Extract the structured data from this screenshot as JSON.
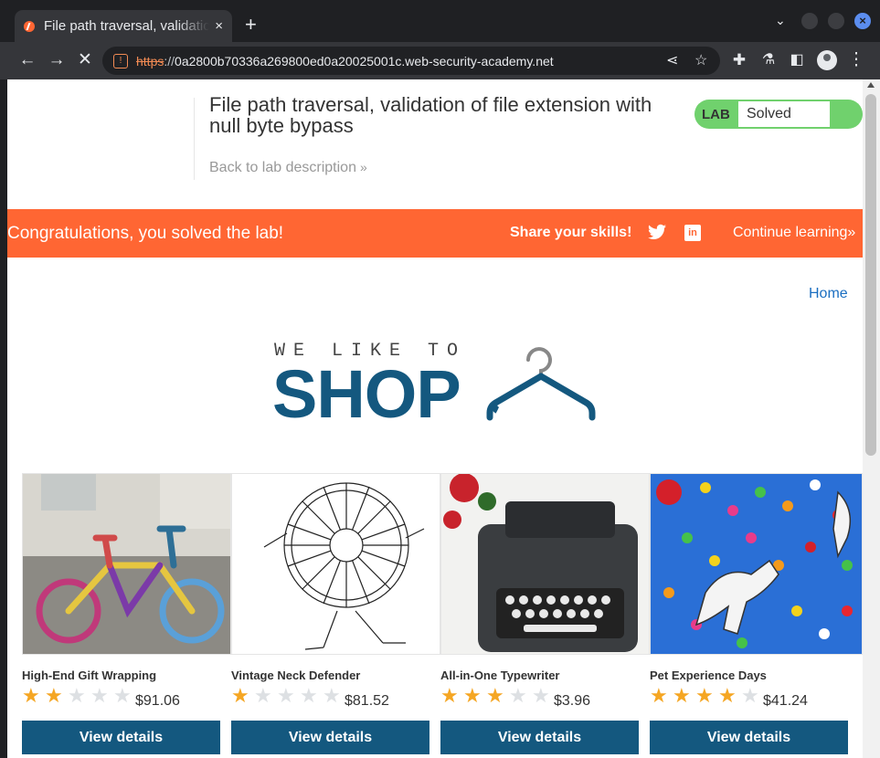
{
  "browser": {
    "tab_title": "File path traversal, validation of file extension with null byte bypass",
    "tab_close": "×",
    "new_tab": "+",
    "url_scheme": "https",
    "url_sep": "://",
    "url_host": "0a2800b70336a269800ed0a20025001c.web-security-academy.net"
  },
  "lab": {
    "title": "File path traversal, validation of file extension with null byte bypass",
    "back_link": "Back to lab description",
    "back_chevron": "»",
    "badge_label": "LAB",
    "badge_status": "Solved"
  },
  "banner": {
    "message": "Congratulations, you solved the lab!",
    "share": "Share your skills!",
    "linkedin": "in",
    "continue": "Continue learning",
    "continue_chevron": "»"
  },
  "nav": {
    "home": "Home"
  },
  "logo": {
    "tagline": "WE LIKE TO",
    "word": "SHOP"
  },
  "products": [
    {
      "name": "High-End Gift Wrapping",
      "rating": 2,
      "price": "$91.06",
      "button": "View details"
    },
    {
      "name": "Vintage Neck Defender",
      "rating": 1,
      "price": "$81.52",
      "button": "View details"
    },
    {
      "name": "All-in-One Typewriter",
      "rating": 3,
      "price": "$3.96",
      "button": "View details"
    },
    {
      "name": "Pet Experience Days",
      "rating": 4,
      "price": "$41.24",
      "button": "View details"
    }
  ],
  "colors": {
    "accent": "#ff6633",
    "brand": "#14587f",
    "solved": "#70d16d",
    "star": "#f5a623"
  }
}
